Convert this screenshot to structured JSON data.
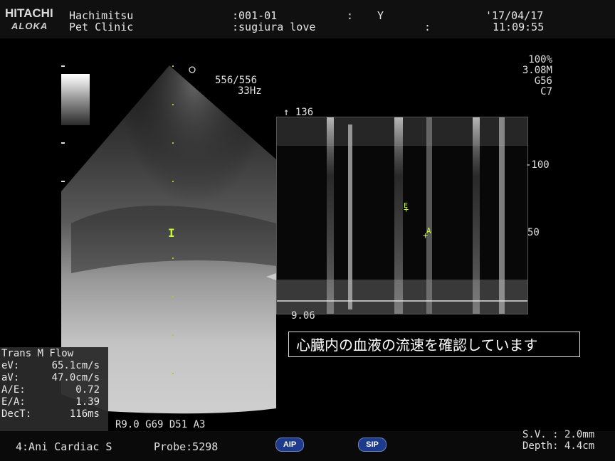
{
  "header": {
    "brand_top": "HITACHI",
    "brand_bottom": "ALOKA",
    "line1": "Hachimitsu",
    "line2": "Pet Clinic",
    "id": ":001-01",
    "owner": ":sugiura love",
    "field_sep1": ":",
    "field_sep2": ":",
    "gender": "Y",
    "date": "'17/04/17",
    "time": "11:09:55"
  },
  "image_params": {
    "frame": "556/556",
    "rate": "33Hz",
    "power": "100%",
    "freq": "3.08M",
    "gain": "G56",
    "contrast": "C7"
  },
  "mmode": {
    "top_label": "↑ 136",
    "bottom_label": "9.06",
    "scale_100": "-100",
    "scale_50": "50",
    "marker_e": "E",
    "marker_a": "A"
  },
  "gate_marker": "I",
  "caption": "心臓内の血液の流速を確認しています",
  "measurements": {
    "title": "Trans M Flow",
    "rows": [
      {
        "label": "eV:",
        "value": "65.1cm/s"
      },
      {
        "label": "aV:",
        "value": "47.0cm/s"
      },
      {
        "label": "A/E:",
        "value": "0.72"
      },
      {
        "label": "E/A:",
        "value": "1.39"
      },
      {
        "label": "DecT:",
        "value": "116ms"
      }
    ]
  },
  "settings_line": "R9.0 G69 D51 A3",
  "bottom": {
    "preset": "4:Ani Cardiac S",
    "probe": "Probe:5298",
    "aip": "AIP",
    "sip": "SIP",
    "sv": "S.V. : 2.0mm",
    "depth": "Depth: 4.4cm"
  },
  "colors": {
    "marker_green": "#c8ff2a",
    "pill_blue": "#1e3a8a"
  }
}
